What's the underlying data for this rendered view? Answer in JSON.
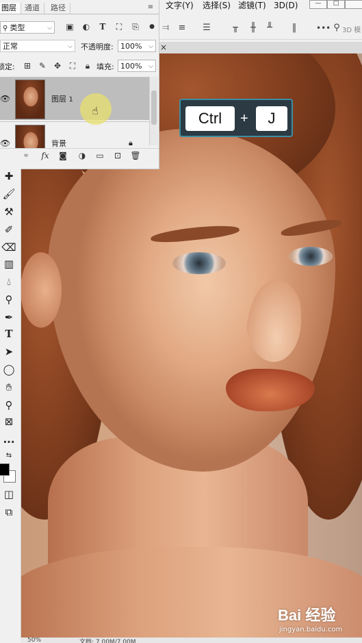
{
  "menu": {
    "items": [
      "文字(Y)",
      "选择(S)",
      "滤镜(T)",
      "3D(D)"
    ]
  },
  "window": {
    "minimize": "—",
    "maximize": "□"
  },
  "options_bar": {
    "search_label": "3D 模"
  },
  "document_tab": {
    "close": "×"
  },
  "layers_panel": {
    "tabs": [
      "图层",
      "通道",
      "路径"
    ],
    "menu_icon": "≡",
    "filter": {
      "label": "类型"
    },
    "blend_mode": "正常",
    "opacity_label": "不透明度:",
    "opacity_value": "100%",
    "lock_label": "锁定:",
    "fill_label": "填充:",
    "fill_value": "100%",
    "layers": [
      {
        "name": "图层",
        "number": "1",
        "selected": true,
        "visible": true
      },
      {
        "name": "背景",
        "selected": false,
        "visible": true,
        "locked": true
      }
    ],
    "footer_icons": [
      "link-icon",
      "fx-icon",
      "mask-icon",
      "adjustment-icon",
      "folder-icon",
      "new-layer-icon",
      "trash-icon"
    ],
    "fx_label": "fx"
  },
  "shortcut_overlay": {
    "key1": "Ctrl",
    "plus": "+",
    "key2": "J"
  },
  "toolbar": {
    "tools": [
      "healing-brush-icon",
      "brush-icon",
      "clone-stamp-icon",
      "history-brush-icon",
      "eraser-icon",
      "gradient-icon",
      "blur-icon",
      "dodge-icon",
      "pen-icon",
      "type-icon",
      "path-select-icon",
      "ellipse-icon",
      "hand-icon",
      "zoom-icon",
      "frame-icon",
      "more-icon"
    ],
    "type_glyph": "T",
    "more_glyph": "..."
  },
  "status": {
    "zoom": "50%",
    "doc": "文档: 7.00M/7.00M"
  },
  "watermark": {
    "logo": "Bai 经验",
    "url": "jingyan.baidu.com"
  },
  "colors": {
    "selection": "#bdbdbd",
    "overlay_bg": "#2b3a43",
    "overlay_border": "#3e8da3",
    "cursor_highlight": "#e8e06e"
  }
}
